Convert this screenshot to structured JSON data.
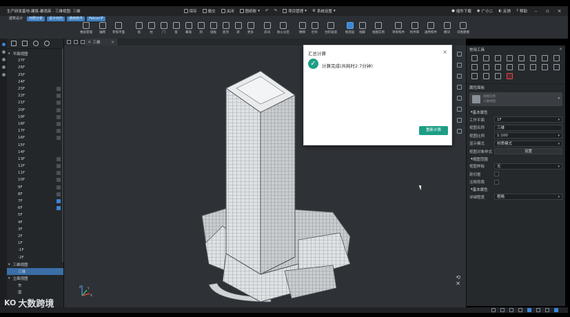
{
  "titlebar": {
    "title": "生产研发基地-建筑-暴雨英 - 三维视图: 三维",
    "quick_actions": [
      "保存",
      "撤交",
      "关闭",
      "图纸账",
      "项目管理",
      "系统设置"
    ],
    "right_items": [
      "插件下载",
      "广小二",
      "反馈",
      "帮助"
    ]
  },
  "ribbon": {
    "tabs": [
      "建筑设计",
      "日照分析",
      "设计日仍",
      "通用软件",
      "Palcon字"
    ],
    "tools": [
      "楼层管理",
      "轴网",
      "参照平面",
      "墙",
      "柱",
      "门",
      "窗",
      "幕墙",
      "洞",
      "墙板",
      "屋顶",
      "梁",
      "更多",
      "房间",
      "防火分区",
      "楼梯",
      "栏杆",
      "台阶坡道",
      "保温层",
      "线脚",
      "视图实例",
      "项目构件",
      "构件库",
      "通用构件",
      "模块",
      "识图建模"
    ]
  },
  "left_panel": {
    "plan_group": "平面视图",
    "floors": [
      "27F",
      "26F",
      "25F",
      "24F",
      "23F",
      "22F",
      "21F",
      "20F",
      "19F",
      "18F",
      "17F",
      "16F",
      "15F",
      "14F",
      "13F",
      "12F",
      "11F",
      "10F",
      "9F",
      "8F",
      "7F",
      "6F",
      "5F",
      "4F",
      "3F",
      "2F",
      "1F",
      "-1F",
      "-2F"
    ],
    "view3d_group": "三维视图",
    "view3d_item": "三维",
    "elev_group": "立面视图",
    "elev_items": [
      "东",
      "南"
    ]
  },
  "viewport": {
    "tab_label": "三维",
    "tab_close": "×",
    "corner_icons": [
      "⟲",
      "✕"
    ],
    "axis_labels": [
      "Z",
      "Y",
      "X"
    ]
  },
  "dialog": {
    "title": "汇总计算",
    "close": "×",
    "message": "计算完成(共耗时2.7分钟)",
    "button": "重新计算",
    "status_color": "#1e9e86"
  },
  "right_panel": {
    "tools_title": "常用工具",
    "props_title": "属性面板",
    "type_line1": "视图实例",
    "type_line2": "三维视图",
    "section_basic": "基本属性",
    "props": [
      {
        "key": "工作平面",
        "value": "1F",
        "kind": "select"
      },
      {
        "key": "视图名称",
        "value": "三维",
        "kind": "text"
      },
      {
        "key": "视图比例",
        "value": "1:100",
        "kind": "select"
      },
      {
        "key": "显示模式",
        "value": "材质模式",
        "kind": "select"
      },
      {
        "key": "视图对象样式",
        "value": "设置",
        "kind": "button"
      }
    ],
    "section_range": "视图范围",
    "range_props": [
      {
        "key": "视图样板",
        "value": "无",
        "kind": "select"
      },
      {
        "key": "剖切框",
        "value": "",
        "kind": "checkbox"
      },
      {
        "key": "注释剪裁",
        "value": "",
        "kind": "checkbox"
      }
    ],
    "section_basic2": "基本属性",
    "detail_props": [
      {
        "key": "详细程度",
        "value": "粗略",
        "kind": "select"
      }
    ]
  },
  "watermark": {
    "logo": "KO",
    "text": "大数跨境"
  }
}
